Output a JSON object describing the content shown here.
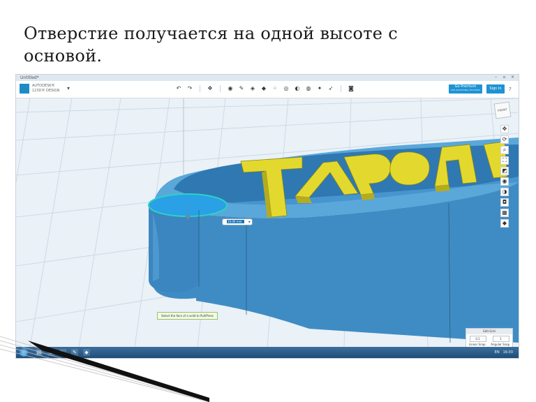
{
  "slide": {
    "title": "Отверстие получается на одной высоте с основой."
  },
  "window": {
    "title": "Untitled*",
    "controls": [
      "–",
      "▫",
      "×"
    ]
  },
  "app": {
    "logo_text": "AUTODESK®\n123D® DESIGN",
    "menu_caret": "▾",
    "toolbar_icons": [
      "undo-icon",
      "redo-icon",
      "transform-icon",
      "primitives-icon",
      "sketch-icon",
      "construct-icon",
      "modify-icon",
      "pattern-icon",
      "group-icon",
      "combine-icon",
      "measure-icon",
      "text-icon",
      "snap-icon",
      "material-icon"
    ],
    "premium_button": "Go Premium",
    "premium_sub": "FOR ADDITIONAL FEATURES",
    "signin_button": "Sign In",
    "help": "?"
  },
  "viewport": {
    "viewcube_label": "FRONT",
    "nav_icons": [
      "pan-icon",
      "orbit-icon",
      "zoom-icon",
      "fit-icon",
      "perspective-icon",
      "visibility-icon",
      "material-view-icon",
      "camera-icon",
      "grid-icon",
      "settings-icon"
    ],
    "dimension_value": "10.00 mm",
    "tooltip": "Select the face of a solid to Pull/Press",
    "edit_grid": {
      "title": "Edit Grid",
      "linear_snap": "0.1",
      "angular_snap": "1",
      "linear_label": "Linear Snap",
      "angular_label": "Angular Snap"
    },
    "colors": {
      "body_blue": "#4a96cf",
      "text_yellow": "#e5dc33",
      "selection_cyan": "#2fd0c4",
      "grid_bg": "#eaf1f7"
    }
  },
  "taskbar": {
    "tray_time": "16:03",
    "tray_lang": "EN",
    "task_icons": [
      "explorer-icon",
      "ie-icon",
      "media-icon",
      "paint-icon",
      "app-icon"
    ]
  }
}
